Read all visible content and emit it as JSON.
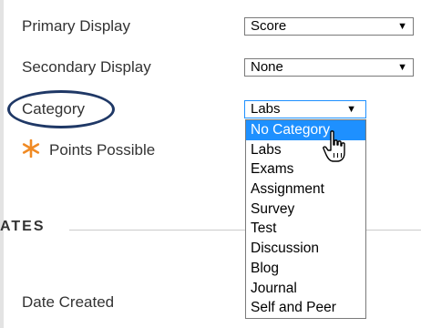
{
  "fields": {
    "primary_display": {
      "label": "Primary Display",
      "value": "Score"
    },
    "secondary_display": {
      "label": "Secondary Display",
      "value": "None"
    },
    "category": {
      "label": "Category",
      "value": "Labs"
    },
    "points_possible": {
      "label": "Points Possible"
    }
  },
  "dropdown": {
    "options": [
      "No Category",
      "Labs",
      "Exams",
      "Assignment",
      "Survey",
      "Test",
      "Discussion",
      "Blog",
      "Journal",
      "Self and Peer"
    ],
    "highlighted": "No Category"
  },
  "section": {
    "heading": "ATES"
  },
  "date_created": {
    "label": "Date Created"
  },
  "arrow_glyph": "▼",
  "colors": {
    "highlight": "#1e90ff",
    "required_star": "#f08a24",
    "annotation_ring": "#1f3866"
  },
  "icons": {
    "required": "asterisk-star-icon",
    "cursor": "hand-pointer-icon"
  }
}
